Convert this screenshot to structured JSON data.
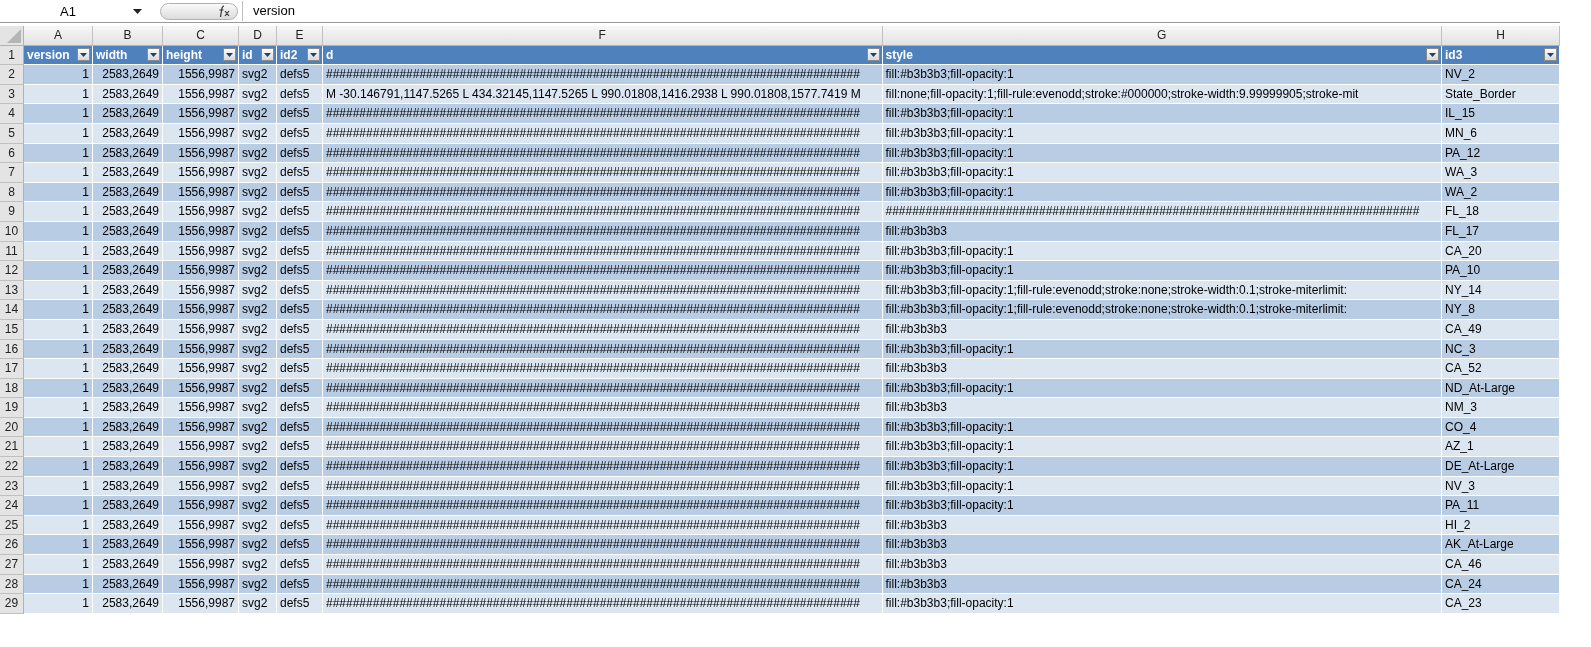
{
  "name_box": "A1",
  "formula": "version",
  "column_letters": [
    "A",
    "B",
    "C",
    "D",
    "E",
    "F",
    "G",
    "H"
  ],
  "header_row": {
    "number": "1",
    "cells": [
      "version",
      "width",
      "height",
      "id",
      "id2",
      "d",
      "style",
      "id3"
    ]
  },
  "rows": [
    {
      "number": "2",
      "cells": [
        "1",
        "2583,2649",
        "1556,9987",
        "svg2",
        "defs5",
        "################################################################################",
        "fill:#b3b3b3;fill-opacity:1",
        "NV_2"
      ]
    },
    {
      "number": "3",
      "cells": [
        "1",
        "2583,2649",
        "1556,9987",
        "svg2",
        "defs5",
        "M -30.146791,1147.5265 L 434.32145,1147.5265 L 990.01808,1416.2938 L 990.01808,1577.7419 M",
        "fill:none;fill-opacity:1;fill-rule:evenodd;stroke:#000000;stroke-width:9.99999905;stroke-mit",
        "State_Border"
      ]
    },
    {
      "number": "4",
      "cells": [
        "1",
        "2583,2649",
        "1556,9987",
        "svg2",
        "defs5",
        "################################################################################",
        "fill:#b3b3b3;fill-opacity:1",
        "IL_15"
      ]
    },
    {
      "number": "5",
      "cells": [
        "1",
        "2583,2649",
        "1556,9987",
        "svg2",
        "defs5",
        "################################################################################",
        "fill:#b3b3b3;fill-opacity:1",
        "MN_6"
      ]
    },
    {
      "number": "6",
      "cells": [
        "1",
        "2583,2649",
        "1556,9987",
        "svg2",
        "defs5",
        "################################################################################",
        "fill:#b3b3b3;fill-opacity:1",
        "PA_12"
      ]
    },
    {
      "number": "7",
      "cells": [
        "1",
        "2583,2649",
        "1556,9987",
        "svg2",
        "defs5",
        "################################################################################",
        "fill:#b3b3b3;fill-opacity:1",
        "WA_3"
      ]
    },
    {
      "number": "8",
      "cells": [
        "1",
        "2583,2649",
        "1556,9987",
        "svg2",
        "defs5",
        "################################################################################",
        "fill:#b3b3b3;fill-opacity:1",
        "WA_2"
      ]
    },
    {
      "number": "9",
      "cells": [
        "1",
        "2583,2649",
        "1556,9987",
        "svg2",
        "defs5",
        "################################################################################",
        "################################################################################",
        "FL_18"
      ]
    },
    {
      "number": "10",
      "cells": [
        "1",
        "2583,2649",
        "1556,9987",
        "svg2",
        "defs5",
        "################################################################################",
        "fill:#b3b3b3",
        "FL_17"
      ]
    },
    {
      "number": "11",
      "cells": [
        "1",
        "2583,2649",
        "1556,9987",
        "svg2",
        "defs5",
        "################################################################################",
        "fill:#b3b3b3;fill-opacity:1",
        "CA_20"
      ]
    },
    {
      "number": "12",
      "cells": [
        "1",
        "2583,2649",
        "1556,9987",
        "svg2",
        "defs5",
        "################################################################################",
        "fill:#b3b3b3;fill-opacity:1",
        "PA_10"
      ]
    },
    {
      "number": "13",
      "cells": [
        "1",
        "2583,2649",
        "1556,9987",
        "svg2",
        "defs5",
        "################################################################################",
        "fill:#b3b3b3;fill-opacity:1;fill-rule:evenodd;stroke:none;stroke-width:0.1;stroke-miterlimit:",
        "NY_14"
      ]
    },
    {
      "number": "14",
      "cells": [
        "1",
        "2583,2649",
        "1556,9987",
        "svg2",
        "defs5",
        "################################################################################",
        "fill:#b3b3b3;fill-opacity:1;fill-rule:evenodd;stroke:none;stroke-width:0.1;stroke-miterlimit:",
        "NY_8"
      ]
    },
    {
      "number": "15",
      "cells": [
        "1",
        "2583,2649",
        "1556,9987",
        "svg2",
        "defs5",
        "################################################################################",
        "fill:#b3b3b3",
        "CA_49"
      ]
    },
    {
      "number": "16",
      "cells": [
        "1",
        "2583,2649",
        "1556,9987",
        "svg2",
        "defs5",
        "################################################################################",
        "fill:#b3b3b3;fill-opacity:1",
        "NC_3"
      ]
    },
    {
      "number": "17",
      "cells": [
        "1",
        "2583,2649",
        "1556,9987",
        "svg2",
        "defs5",
        "################################################################################",
        "fill:#b3b3b3",
        "CA_52"
      ]
    },
    {
      "number": "18",
      "cells": [
        "1",
        "2583,2649",
        "1556,9987",
        "svg2",
        "defs5",
        "################################################################################",
        "fill:#b3b3b3;fill-opacity:1",
        "ND_At-Large"
      ]
    },
    {
      "number": "19",
      "cells": [
        "1",
        "2583,2649",
        "1556,9987",
        "svg2",
        "defs5",
        "################################################################################",
        "fill:#b3b3b3",
        "NM_3"
      ]
    },
    {
      "number": "20",
      "cells": [
        "1",
        "2583,2649",
        "1556,9987",
        "svg2",
        "defs5",
        "################################################################################",
        "fill:#b3b3b3;fill-opacity:1",
        "CO_4"
      ]
    },
    {
      "number": "21",
      "cells": [
        "1",
        "2583,2649",
        "1556,9987",
        "svg2",
        "defs5",
        "################################################################################",
        "fill:#b3b3b3;fill-opacity:1",
        "AZ_1"
      ]
    },
    {
      "number": "22",
      "cells": [
        "1",
        "2583,2649",
        "1556,9987",
        "svg2",
        "defs5",
        "################################################################################",
        "fill:#b3b3b3;fill-opacity:1",
        "DE_At-Large"
      ]
    },
    {
      "number": "23",
      "cells": [
        "1",
        "2583,2649",
        "1556,9987",
        "svg2",
        "defs5",
        "################################################################################",
        "fill:#b3b3b3;fill-opacity:1",
        "NV_3"
      ]
    },
    {
      "number": "24",
      "cells": [
        "1",
        "2583,2649",
        "1556,9987",
        "svg2",
        "defs5",
        "################################################################################",
        "fill:#b3b3b3;fill-opacity:1",
        "PA_11"
      ]
    },
    {
      "number": "25",
      "cells": [
        "1",
        "2583,2649",
        "1556,9987",
        "svg2",
        "defs5",
        "################################################################################",
        "fill:#b3b3b3",
        "HI_2"
      ]
    },
    {
      "number": "26",
      "cells": [
        "1",
        "2583,2649",
        "1556,9987",
        "svg2",
        "defs5",
        "################################################################################",
        "fill:#b3b3b3",
        "AK_At-Large"
      ]
    },
    {
      "number": "27",
      "cells": [
        "1",
        "2583,2649",
        "1556,9987",
        "svg2",
        "defs5",
        "################################################################################",
        "fill:#b3b3b3",
        "CA_46"
      ]
    },
    {
      "number": "28",
      "cells": [
        "1",
        "2583,2649",
        "1556,9987",
        "svg2",
        "defs5",
        "################################################################################",
        "fill:#b3b3b3",
        "CA_24"
      ]
    },
    {
      "number": "29",
      "cells": [
        "1",
        "2583,2649",
        "1556,9987",
        "svg2",
        "defs5",
        "################################################################################",
        "fill:#b3b3b3;fill-opacity:1",
        "CA_23"
      ]
    }
  ]
}
